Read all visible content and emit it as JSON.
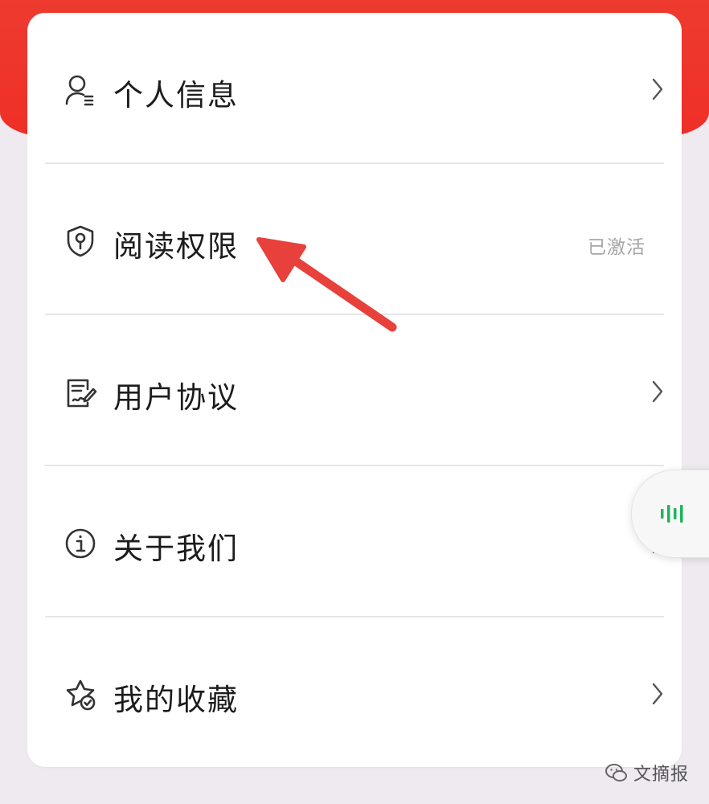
{
  "menu": {
    "items": [
      {
        "label": "个人信息",
        "icon": "user-profile-icon"
      },
      {
        "label": "阅读权限",
        "icon": "shield-lock-icon",
        "status": "已激活"
      },
      {
        "label": "用户协议",
        "icon": "document-sign-icon"
      },
      {
        "label": "关于我们",
        "icon": "info-icon"
      },
      {
        "label": "我的收藏",
        "icon": "star-check-icon"
      }
    ]
  },
  "watermark": {
    "text": "文摘报"
  },
  "colors": {
    "header": "#ef2f27",
    "arrow": "#e8403b",
    "float_accent": "#22b35c"
  }
}
